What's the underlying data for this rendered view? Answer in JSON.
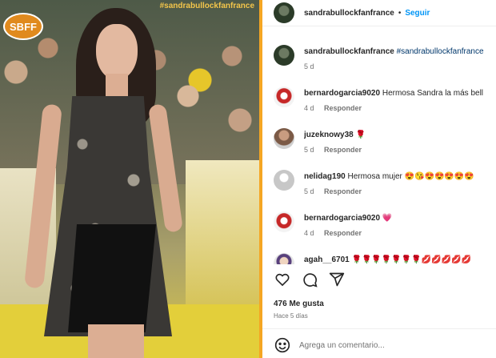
{
  "photo": {
    "logo_text": "SBFF",
    "watermark": "#sandrabullockfanfrance"
  },
  "post": {
    "username": "sandrabullockfanfrance",
    "separator": "•",
    "follow_label": "Seguir",
    "caption": {
      "username": "sandrabullockfanfrance",
      "hashtag": "#sandrabullockfanfrance",
      "time": "5 d"
    },
    "reply_label": "Responder",
    "comments": [
      {
        "username": "bernardogarcia9020",
        "text": "Hermosa Sandra la más bell",
        "time": "4 d"
      },
      {
        "username": "juzeknowy38",
        "text": "🌹",
        "time": "5 d"
      },
      {
        "username": "nelidag190",
        "text": "Hermosa mujer 😍😘😍😍😍😍😍",
        "time": "5 d"
      },
      {
        "username": "bernardogarcia9020",
        "text": "💗",
        "time": "4 d"
      },
      {
        "username": "agah__6701",
        "text": "🌹🌹🌹🌹🌹🌹🌹💋💋💋💋💋",
        "time": ""
      }
    ],
    "icons": [
      "heart-icon",
      "comment-icon",
      "share-icon",
      "emoji-icon"
    ],
    "likes": "476 Me gusta",
    "posted": "Hace 5 días",
    "comment_placeholder": "Agrega un comentario..."
  }
}
